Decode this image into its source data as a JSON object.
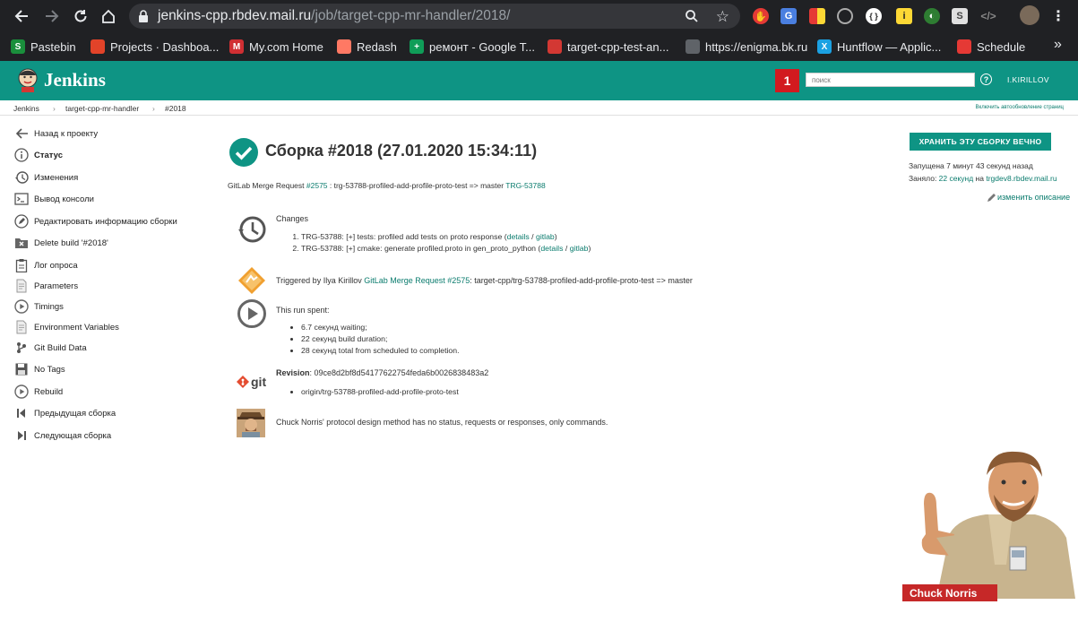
{
  "browser": {
    "url_host": "jenkins-cpp.rbdev.mail.ru",
    "url_path": "/job/target-cpp-mr-handler/2018/",
    "bookmarks": [
      {
        "label": "Pastebin",
        "icon": "pastebin-icon",
        "color": "#1a8f3c",
        "glyph": "S"
      },
      {
        "label": "Projects · Dashboa...",
        "icon": "gitlab-icon",
        "color": "#e24329",
        "glyph": ""
      },
      {
        "label": "My.com Home",
        "icon": "mycom-icon",
        "color": "#d02f33",
        "glyph": "M"
      },
      {
        "label": "Redash",
        "icon": "redash-icon",
        "color": "#ff7964",
        "glyph": ""
      },
      {
        "label": "ремонт - Google T...",
        "icon": "google-sheets-icon",
        "color": "#0f9d58",
        "glyph": "+"
      },
      {
        "label": "target-cpp-test-an...",
        "icon": "jenkins-icon",
        "color": "#d33833",
        "glyph": ""
      },
      {
        "label": "https://enigma.bk.ru",
        "icon": "globe-icon",
        "color": "#5f6368",
        "glyph": ""
      },
      {
        "label": "Huntflow — Applic...",
        "icon": "huntflow-icon",
        "color": "#1ba1e2",
        "glyph": "X"
      },
      {
        "label": "Schedule",
        "icon": "schedule-icon",
        "color": "#e53935",
        "glyph": ""
      }
    ],
    "more": "»"
  },
  "header": {
    "logo": "Jenkins",
    "notifications": "1",
    "search_placeholder": "поиск",
    "user": "I.KIRILLOV"
  },
  "breadcrumbs": {
    "items": [
      "Jenkins",
      "target-cpp-mr-handler",
      "#2018"
    ],
    "sep": "›",
    "autorefresh": "Включить автообновление страниц"
  },
  "sidebar": {
    "tasks": [
      {
        "label": "Назад к проекту",
        "icon": "arrow-left-icon",
        "bold": false
      },
      {
        "label": "Статус",
        "icon": "info-icon",
        "bold": true
      },
      {
        "label": "Изменения",
        "icon": "history-icon",
        "bold": false
      },
      {
        "label": "Вывод консоли",
        "icon": "terminal-icon",
        "bold": false
      },
      {
        "label": "Редактировать информацию сборки",
        "icon": "edit-icon",
        "bold": false
      },
      {
        "label": "Delete build '#2018'",
        "icon": "delete-folder-icon",
        "bold": false
      },
      {
        "label": "Лог опроса",
        "icon": "clipboard-icon",
        "bold": false
      },
      {
        "label": "Parameters",
        "icon": "document-icon",
        "bold": false
      },
      {
        "label": "Timings",
        "icon": "play-circle-icon",
        "bold": false
      },
      {
        "label": "Environment Variables",
        "icon": "document-icon",
        "bold": false
      },
      {
        "label": "Git Build Data",
        "icon": "git-icon",
        "bold": false
      },
      {
        "label": "No Tags",
        "icon": "save-icon",
        "bold": false
      },
      {
        "label": "Rebuild",
        "icon": "play-circle-icon",
        "bold": false
      },
      {
        "label": "Предыдущая сборка",
        "icon": "skip-previous-icon",
        "bold": false
      },
      {
        "label": "Следующая сборка",
        "icon": "skip-next-icon",
        "bold": false
      }
    ]
  },
  "build": {
    "title": "Сборка #2018 (27.01.2020 15:34:11)",
    "keep_button": "ХРАНИТЬ ЭТУ СБОРКУ ВЕЧНО",
    "started": "Запущена 7 минут 43 секунд назад",
    "took_prefix": "Заняло: ",
    "took_value": "22 секунд",
    "took_on": " на ",
    "took_node": "trgdev8.rbdev.mail.ru",
    "edit_description": "изменить описание",
    "mr_prefix": "GitLab Merge Request ",
    "mr_link": "#2575",
    "mr_text": " : trg-53788-profiled-add-profile-proto-test => master ",
    "mr_ticket": "TRG-53788"
  },
  "changes": {
    "title": "Changes",
    "items": [
      {
        "text": "TRG-53788: [+] tests: profiled add tests on proto response (",
        "details": "details",
        "slash": " / ",
        "gitlab": "gitlab",
        "close": ")"
      },
      {
        "text": "TRG-53788: [+] cmake: generate profiled.proto in gen_proto_python (",
        "details": "details",
        "slash": " / ",
        "gitlab": "gitlab",
        "close": ")"
      }
    ]
  },
  "trigger": {
    "prefix": "Triggered by Ilya Kirillov ",
    "link": "GitLab Merge Request #2575",
    "suffix": ": target-cpp/trg-53788-profiled-add-profile-proto-test => master"
  },
  "timing": {
    "title": "This run spent:",
    "items": [
      "6.7 секунд waiting;",
      "22 секунд build duration;",
      "28 секунд total from scheduled to completion."
    ]
  },
  "revision": {
    "label": "Revision",
    "value": ": 09ce8d2bf8d54177622754feda6b0026838483a2",
    "branches": [
      "origin/trg-53788-profiled-add-profile-proto-test"
    ],
    "git_logo": "git"
  },
  "chuck": {
    "fact": "Chuck Norris' protocol design method has no status, requests or responses, only commands.",
    "caption": "Chuck Norris"
  },
  "colors": {
    "jenkins_teal": "#0e9484",
    "link": "#0b7c6e",
    "success": "#0e9484",
    "alert": "#d21a1f"
  }
}
